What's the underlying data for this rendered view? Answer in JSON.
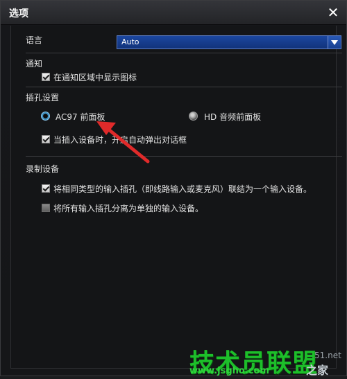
{
  "window": {
    "title": "选项"
  },
  "language": {
    "label": "语言",
    "value": "Auto"
  },
  "notify": {
    "heading": "通知",
    "show_icon": {
      "label": "在通知区域中显示图标",
      "checked": true
    }
  },
  "jack": {
    "heading": "插孔设置",
    "options": [
      {
        "label": "AC97 前面板",
        "selected": true
      },
      {
        "label": "HD 音频前面板",
        "selected": false
      }
    ],
    "auto_popup": {
      "label": "当插入设备时，开启自动弹出对话框",
      "checked": true
    }
  },
  "recording": {
    "heading": "录制设备",
    "options": [
      {
        "label": "将相同类型的输入插孔（即线路输入或麦克风）联结为一个输入设备。",
        "checked": true
      },
      {
        "label": "将所有输入插孔分离为单独的输入设备。",
        "checked": false
      }
    ]
  },
  "watermark": {
    "main": "技术员联盟",
    "url": "www.jsgho.com",
    "side": "51.net",
    "side2": "之家"
  },
  "colors": {
    "accent": "#1b47a0",
    "annotation_arrow": "#e02a2a",
    "watermark": "#1dbf2a"
  }
}
